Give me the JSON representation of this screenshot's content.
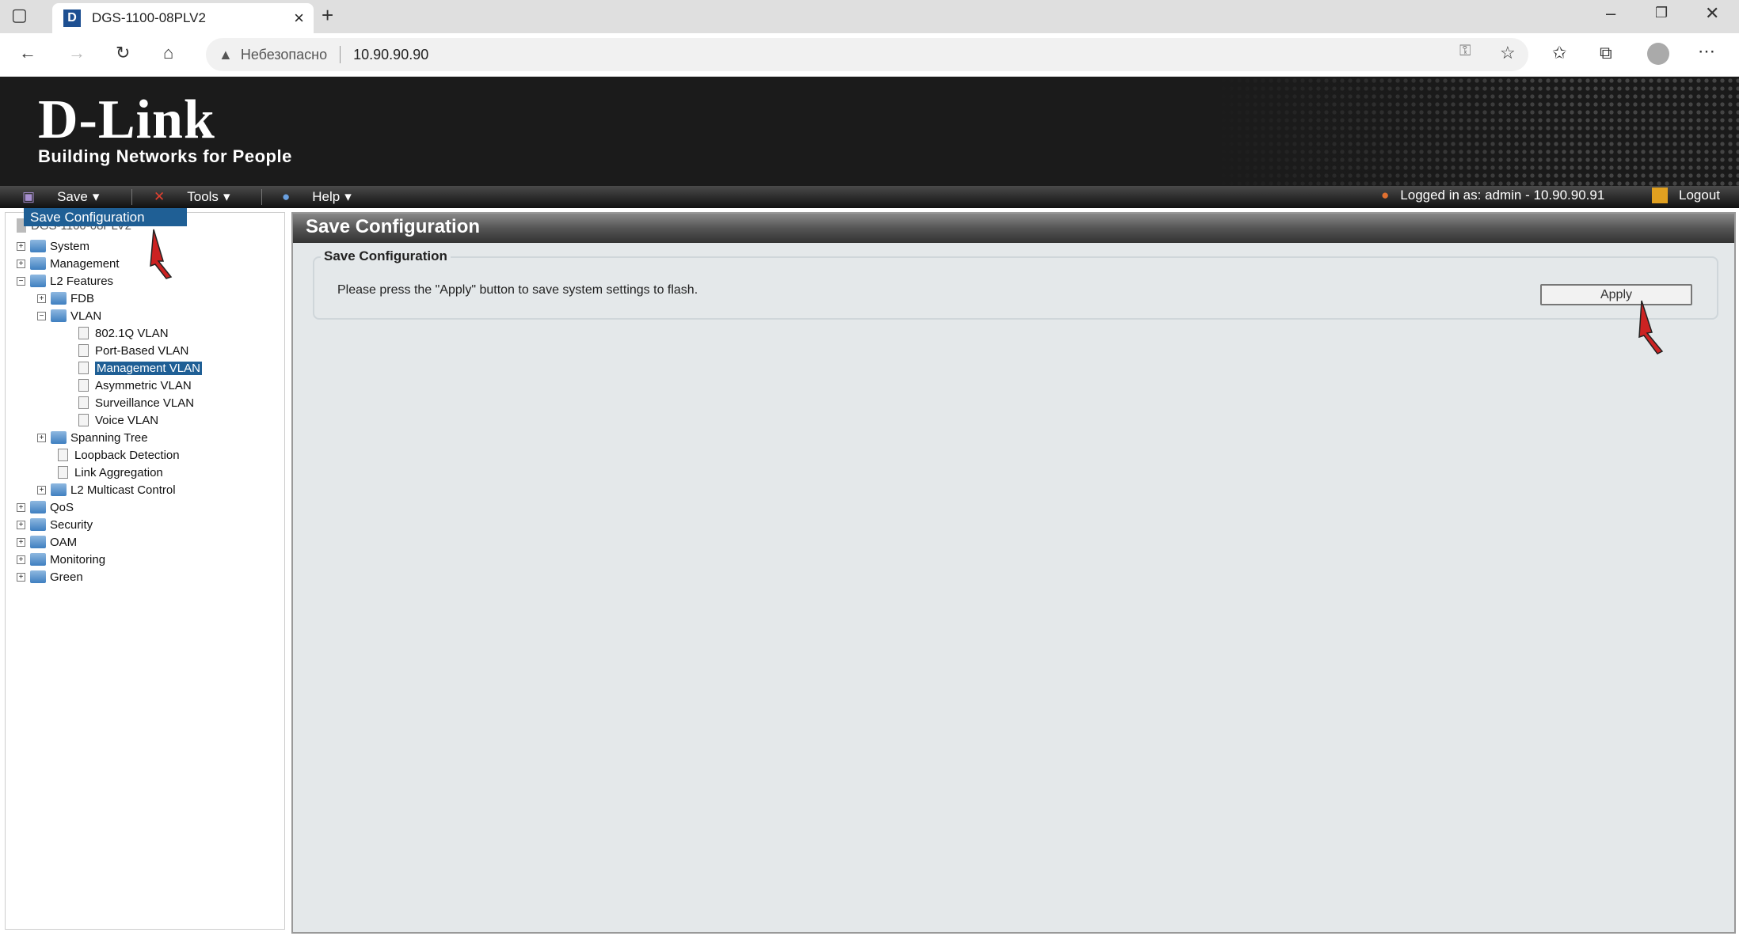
{
  "browser": {
    "tab_title": "DGS-1100-08PLV2",
    "security_label": "Небезопасно",
    "url": "10.90.90.90"
  },
  "header": {
    "logo_text": "D-Link",
    "logo_tagline": "Building Networks for People"
  },
  "menu": {
    "save": "Save",
    "tools": "Tools",
    "help": "Help",
    "logged_in": "Logged in as: admin - 10.90.90.91",
    "logout": "Logout",
    "dropdown_item": "Save Configuration"
  },
  "tree": {
    "root": "DGS-1100-08PLV2",
    "items": [
      {
        "label": "System",
        "level": 0,
        "type": "folder",
        "toggle": "+"
      },
      {
        "label": "Management",
        "level": 0,
        "type": "folder",
        "toggle": "+"
      },
      {
        "label": "L2 Features",
        "level": 0,
        "type": "folder",
        "toggle": "-"
      },
      {
        "label": "FDB",
        "level": 1,
        "type": "folder",
        "toggle": "+"
      },
      {
        "label": "VLAN",
        "level": 1,
        "type": "folder",
        "toggle": "-"
      },
      {
        "label": "802.1Q VLAN",
        "level": 2,
        "type": "doc"
      },
      {
        "label": "Port-Based VLAN",
        "level": 2,
        "type": "doc"
      },
      {
        "label": "Management VLAN",
        "level": 2,
        "type": "doc",
        "selected": true
      },
      {
        "label": "Asymmetric VLAN",
        "level": 2,
        "type": "doc"
      },
      {
        "label": "Surveillance VLAN",
        "level": 2,
        "type": "doc"
      },
      {
        "label": "Voice VLAN",
        "level": 2,
        "type": "doc"
      },
      {
        "label": "Spanning Tree",
        "level": 1,
        "type": "folder",
        "toggle": "+"
      },
      {
        "label": "Loopback Detection",
        "level": 1,
        "type": "doc"
      },
      {
        "label": "Link Aggregation",
        "level": 1,
        "type": "doc"
      },
      {
        "label": "L2 Multicast Control",
        "level": 1,
        "type": "folder",
        "toggle": "+"
      },
      {
        "label": "QoS",
        "level": 0,
        "type": "folder",
        "toggle": "+"
      },
      {
        "label": "Security",
        "level": 0,
        "type": "folder",
        "toggle": "+"
      },
      {
        "label": "OAM",
        "level": 0,
        "type": "folder",
        "toggle": "+"
      },
      {
        "label": "Monitoring",
        "level": 0,
        "type": "folder",
        "toggle": "+"
      },
      {
        "label": "Green",
        "level": 0,
        "type": "folder",
        "toggle": "+"
      }
    ]
  },
  "main": {
    "title": "Save Configuration",
    "legend": "Save Configuration",
    "message": "Please press the \"Apply\" button to save system settings to flash.",
    "apply": "Apply"
  },
  "colors": {
    "accent": "#1f5f95",
    "annotation_arrow": "#cc2222"
  }
}
